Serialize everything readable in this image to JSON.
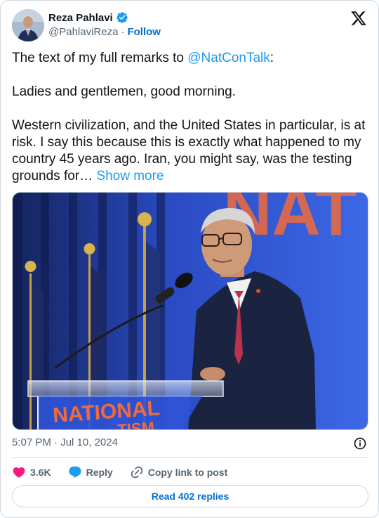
{
  "author": {
    "name": "Reza Pahlavi",
    "handle": "@PahlaviReza",
    "separator": "·",
    "follow_label": "Follow"
  },
  "tweet": {
    "line1_prefix": "The text of my full remarks to ",
    "mention": "@NatConTalk",
    "line1_suffix": ":",
    "para2": "Ladies and gentlemen, good morning.",
    "para3": "Western civilization, and the United States in particular, is at risk. I say this because this is exactly what happened to my country 45 years ago. Iran, you might say, was the testing grounds for… ",
    "show_more": "Show more"
  },
  "photo": {
    "podium_text_line1": "NATIONAL",
    "podium_text_line2": "TISM",
    "backdrop_text": "NAT",
    "colors": {
      "backdrop": "#2b55d6",
      "accent": "#f06b3c",
      "flag_blue": "#1d2a66"
    }
  },
  "meta": {
    "time": "5:07 PM",
    "separator": "·",
    "date": "Jul 10, 2024"
  },
  "actions": {
    "likes": "3.6K",
    "reply_label": "Reply",
    "copy_label": "Copy link to post"
  },
  "read_replies_label": "Read 402 replies",
  "icons": {
    "verified": "verified-badge-icon",
    "x_logo": "x-logo-icon",
    "info": "info-icon",
    "heart": "heart-icon",
    "reply": "reply-bubble-icon",
    "link": "link-icon"
  },
  "colors": {
    "link": "#1d9bf0",
    "heart": "#f91880",
    "text": "#0f1419",
    "muted": "#536471"
  }
}
